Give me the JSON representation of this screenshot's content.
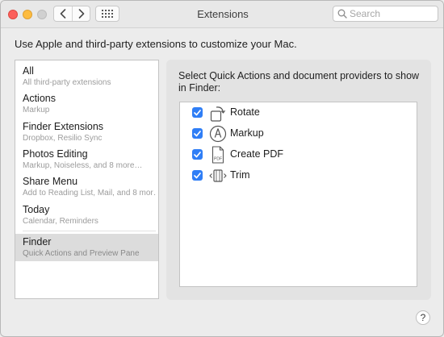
{
  "window": {
    "title": "Extensions"
  },
  "toolbar": {
    "search_placeholder": "Search"
  },
  "description": "Use Apple and third-party extensions to customize your Mac.",
  "sidebar": {
    "items": [
      {
        "title": "All",
        "subtitle": "All third-party extensions",
        "selected": false
      },
      {
        "title": "Actions",
        "subtitle": "Markup",
        "selected": false
      },
      {
        "title": "Finder Extensions",
        "subtitle": "Dropbox, Resilio Sync",
        "selected": false
      },
      {
        "title": "Photos Editing",
        "subtitle": "Markup, Noiseless, and 8 more…",
        "selected": false
      },
      {
        "title": "Share Menu",
        "subtitle": "Add to Reading List, Mail, and 8 mor…",
        "selected": false
      },
      {
        "title": "Today",
        "subtitle": "Calendar, Reminders",
        "selected": false
      },
      {
        "title": "Finder",
        "subtitle": "Quick Actions and Preview Pane",
        "selected": true
      }
    ]
  },
  "panel": {
    "title": "Select Quick Actions and document providers to show in Finder:",
    "items": [
      {
        "label": "Rotate",
        "checked": true,
        "icon": "rotate-icon"
      },
      {
        "label": "Markup",
        "checked": true,
        "icon": "markup-icon"
      },
      {
        "label": "Create PDF",
        "checked": true,
        "icon": "pdf-icon",
        "icon_text": "PDF"
      },
      {
        "label": "Trim",
        "checked": true,
        "icon": "trim-icon"
      }
    ]
  },
  "help_label": "?",
  "colors": {
    "checkbox": "#2f7ef6",
    "selection": "#dcdcdc"
  }
}
